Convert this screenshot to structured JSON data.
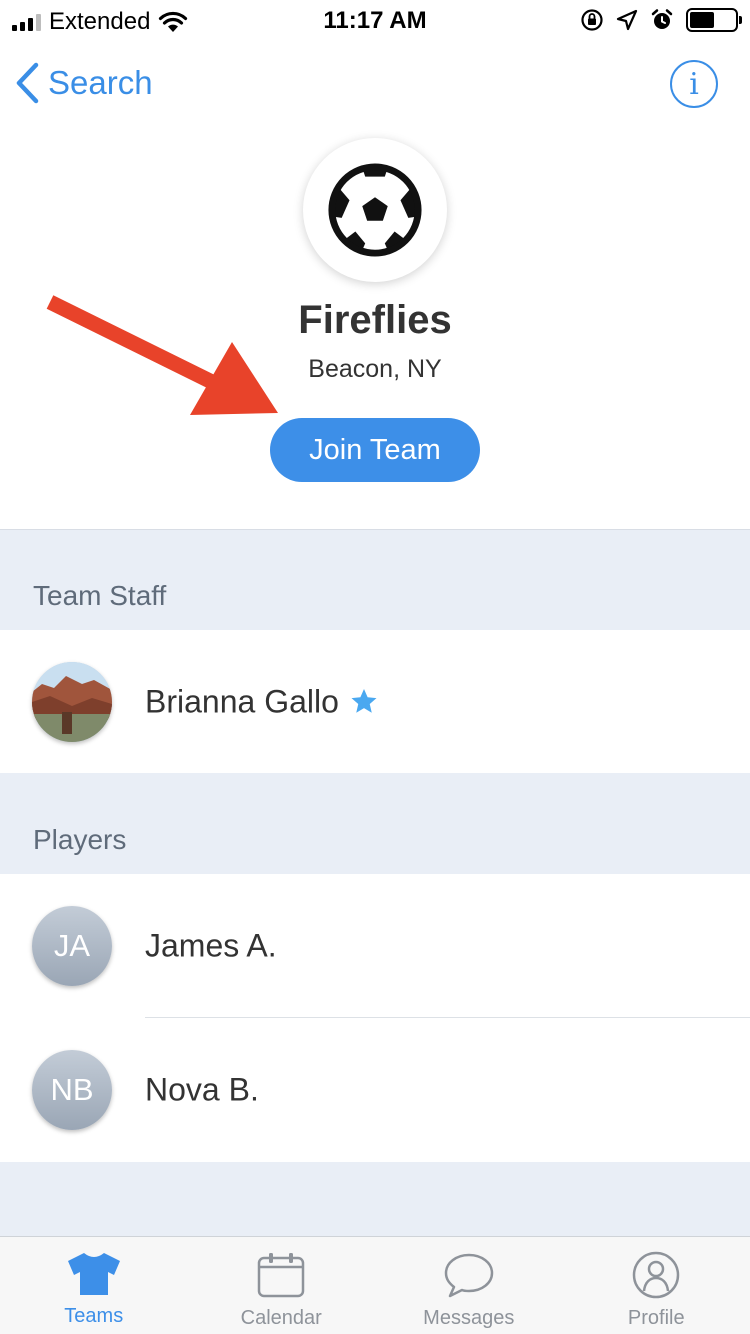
{
  "status_bar": {
    "carrier": "Extended",
    "time": "11:17 AM"
  },
  "nav": {
    "back_label": "Search",
    "info_glyph": "i"
  },
  "team": {
    "name": "Fireflies",
    "location": "Beacon, NY",
    "join_label": "Join Team"
  },
  "sections": {
    "staff": {
      "title": "Team Staff",
      "members": [
        {
          "name": "Brianna Gallo",
          "badge": "star-icon"
        }
      ]
    },
    "players": {
      "title": "Players",
      "members": [
        {
          "initials": "JA",
          "name": "James A."
        },
        {
          "initials": "NB",
          "name": "Nova B."
        }
      ]
    }
  },
  "tabs": [
    {
      "label": "Teams",
      "icon": "jersey-icon",
      "active": true
    },
    {
      "label": "Calendar",
      "icon": "calendar-icon",
      "active": false
    },
    {
      "label": "Messages",
      "icon": "chat-bubble-icon",
      "active": false
    },
    {
      "label": "Profile",
      "icon": "person-icon",
      "active": false
    }
  ],
  "colors": {
    "accent": "#3d8fe8",
    "arrow": "#e8432a",
    "section_bg": "#e9eef6",
    "star": "#4aa8f0"
  }
}
